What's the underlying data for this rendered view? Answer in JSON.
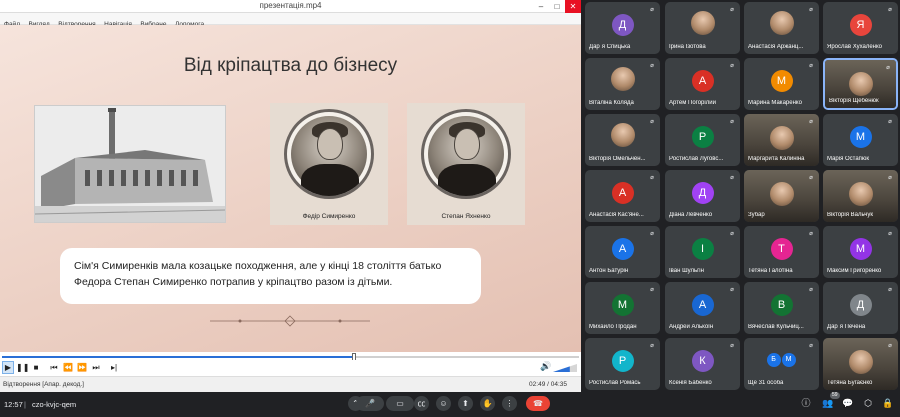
{
  "player": {
    "window_title": "презентація.mp4",
    "menu": [
      "Файл",
      "Вигляд",
      "Відтворення",
      "Навігація",
      "Вибране",
      "Допомога"
    ],
    "status_left": "Відтворення [Апар. декод.]",
    "status_right": "02:49 / 04:35",
    "progress": 0.61,
    "volume": 0.7
  },
  "slide": {
    "title": "Від кріпацтва до бізнесу",
    "portrait_1_caption": "Федір Симиренко",
    "portrait_2_caption": "Степан Яхненко",
    "text": "Сім'я Симиренків мала козацьке походження, але у кінці 18 століття батько Федора Степан Симиренко потрапив у кріпацтво разом із дітьми."
  },
  "participants": [
    {
      "name": "Дар`я Спицька",
      "initial": "Д",
      "color": "#7e57c2",
      "kind": "avatar"
    },
    {
      "name": "Ірина Ізотова",
      "initial": "",
      "color": "",
      "kind": "photo"
    },
    {
      "name": "Анастасія Аржанц...",
      "initial": "",
      "color": "",
      "kind": "photo"
    },
    {
      "name": "Ярослав Хухаленко",
      "initial": "Я",
      "color": "#e8453c",
      "kind": "avatar"
    },
    {
      "name": "Віталіна Коляда",
      "initial": "",
      "color": "",
      "kind": "photo"
    },
    {
      "name": "Артем Погорілий",
      "initial": "А",
      "color": "#d93025",
      "kind": "avatar"
    },
    {
      "name": "Марина Макаренко",
      "initial": "М",
      "color": "#f28b00",
      "kind": "avatar"
    },
    {
      "name": "Вікторія Щебенюк",
      "initial": "",
      "color": "",
      "kind": "video"
    },
    {
      "name": "Вікторія Омельчен...",
      "initial": "",
      "color": "",
      "kind": "photo"
    },
    {
      "name": "Ростислав Луговс...",
      "initial": "Р",
      "color": "#0b8043",
      "kind": "avatar"
    },
    {
      "name": "Маргарита Калиніна",
      "initial": "",
      "color": "",
      "kind": "video"
    },
    {
      "name": "Марія Остапюк",
      "initial": "М",
      "color": "#1a73e8",
      "kind": "avatar"
    },
    {
      "name": "Анастасія Кас'яне...",
      "initial": "А",
      "color": "#d93025",
      "kind": "avatar"
    },
    {
      "name": "Діана Левченко",
      "initial": "Д",
      "color": "#a142f4",
      "kind": "avatar"
    },
    {
      "name": "Зубар",
      "initial": "",
      "color": "",
      "kind": "video"
    },
    {
      "name": "Вікторія Вальчук",
      "initial": "",
      "color": "",
      "kind": "video"
    },
    {
      "name": "Антон Батурін",
      "initial": "А",
      "color": "#1a73e8",
      "kind": "avatar"
    },
    {
      "name": "Іван Шульгін",
      "initial": "І",
      "color": "#0b8043",
      "kind": "avatar"
    },
    {
      "name": "Тетяна Галотіна",
      "initial": "Т",
      "color": "#e52592",
      "kind": "avatar"
    },
    {
      "name": "Максим Григоренко",
      "initial": "М",
      "color": "#9334e6",
      "kind": "avatar"
    },
    {
      "name": "Михайло Продан",
      "initial": "М",
      "color": "#137333",
      "kind": "avatar"
    },
    {
      "name": "Андрей Алькоїн",
      "initial": "А",
      "color": "#1967d2",
      "kind": "avatar"
    },
    {
      "name": "Вячеслав Кульчиц...",
      "initial": "В",
      "color": "#137333",
      "kind": "avatar"
    },
    {
      "name": "Дар`я Печена",
      "initial": "Д",
      "color": "#80868b",
      "kind": "avatar"
    },
    {
      "name": "Ростислав Ромась",
      "initial": "Р",
      "color": "#12b5cb",
      "kind": "avatar"
    },
    {
      "name": "Ксенія Бабенко",
      "initial": "К",
      "color": "#7e57c2",
      "kind": "avatar"
    },
    {
      "name": "Ще 31 особа",
      "initial": "",
      "color": "",
      "kind": "more"
    },
    {
      "name": "Тетяна Бугаєнко",
      "initial": "",
      "color": "",
      "kind": "video"
    }
  ],
  "more_initials": [
    "Б",
    "М"
  ],
  "meetbar": {
    "time": "12:57",
    "separator": "|",
    "code": "czo-kvjc-qem",
    "people_count": "59"
  }
}
